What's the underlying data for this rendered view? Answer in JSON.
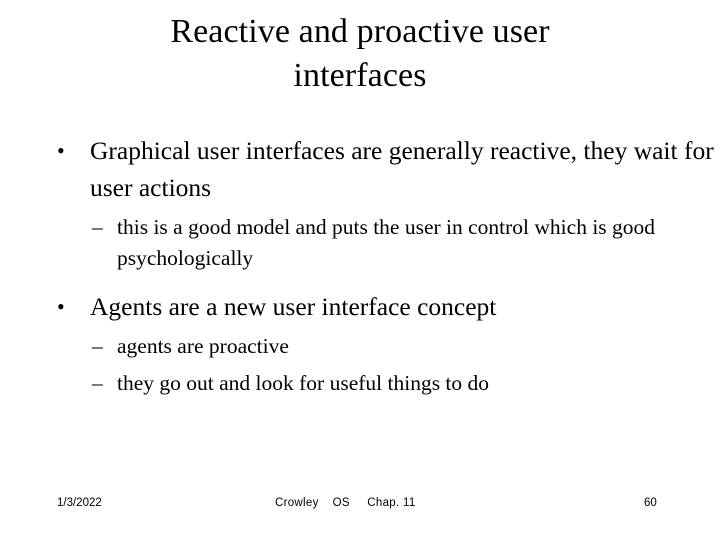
{
  "slide": {
    "title": "Reactive and proactive user interfaces",
    "title_line_1": "Reactive and proactive user",
    "title_line_2": "interfaces",
    "bullet_marker_level1": "•",
    "bullet_marker_level2": "–",
    "bullets": [
      {
        "level": 1,
        "text": "Graphical user interfaces are generally reactive, they wait for user actions"
      },
      {
        "level": 2,
        "text": "this is a good model and puts the user in control which is good psychologically"
      },
      {
        "level": 1,
        "text": "Agents are a new user interface concept"
      },
      {
        "level": 2,
        "text": "agents are proactive"
      },
      {
        "level": 2,
        "text": "they go out and look for useful things to do"
      }
    ]
  },
  "footer": {
    "date": "1/3/2022",
    "center": "Crowley    OS     Chap. 11",
    "author": "Crowley",
    "course": "OS",
    "chapter": "Chap. 11",
    "page_number": "60"
  },
  "colors": {
    "background": "#ffffff",
    "text": "#000000"
  }
}
